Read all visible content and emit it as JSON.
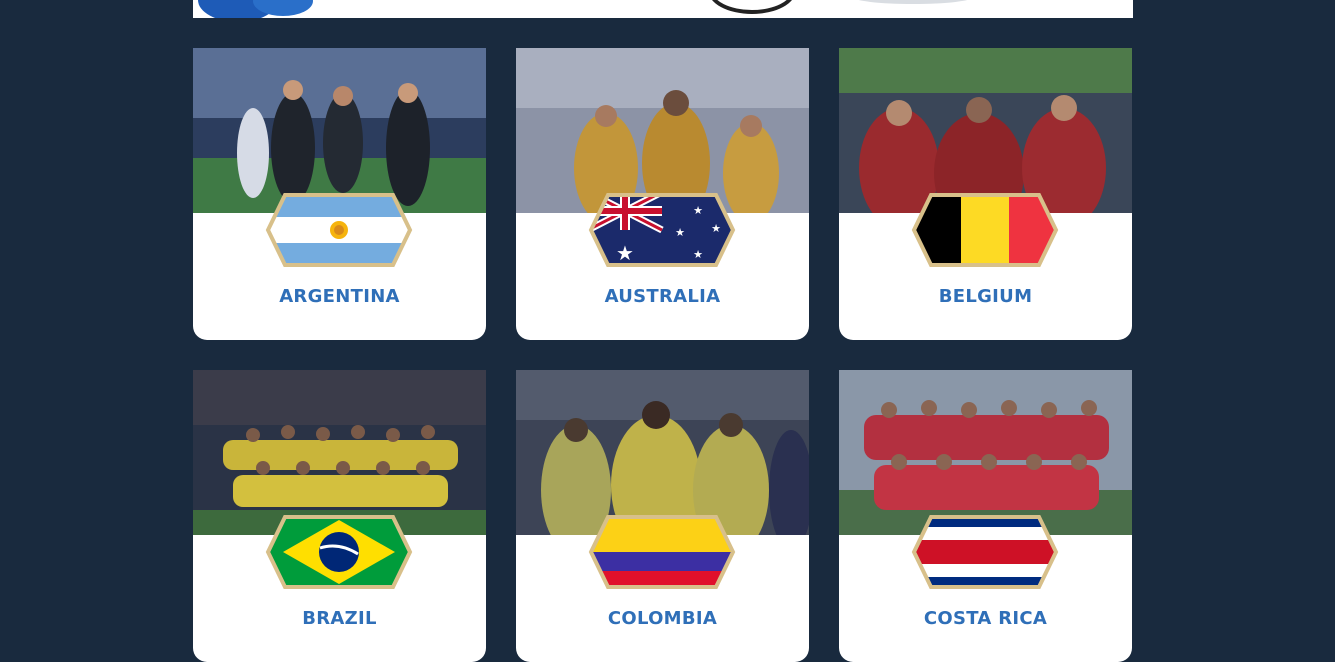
{
  "teams": [
    {
      "name": "ARGENTINA"
    },
    {
      "name": "AUSTRALIA"
    },
    {
      "name": "BELGIUM"
    },
    {
      "name": "BRAZIL"
    },
    {
      "name": "COLOMBIA"
    },
    {
      "name": "COSTA RICA"
    }
  ],
  "colors": {
    "background": "#192a3e",
    "card": "#ffffff",
    "team_name": "#2f6fb8",
    "badge_border": "#d8c08a"
  }
}
